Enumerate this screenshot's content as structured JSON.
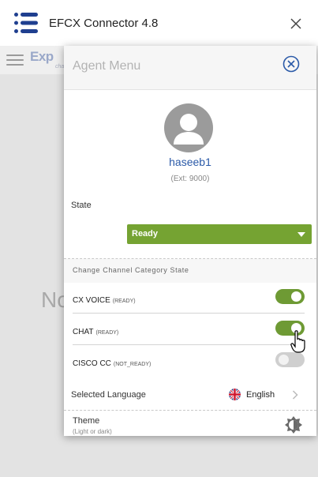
{
  "window": {
    "title": "EFCX Connector 4.8"
  },
  "background_app": {
    "logo_text": "Exp",
    "logo_subtext": "cha",
    "center_text": "No"
  },
  "agent_menu": {
    "title": "Agent Menu",
    "user": {
      "name": "haseeb1",
      "ext": "(Ext: 9000)"
    },
    "state": {
      "label": "State",
      "selected": "Ready"
    },
    "channel_section": {
      "heading": "Change Channel Category State",
      "channels": [
        {
          "name": "CX VOICE",
          "status": "(READY)",
          "enabled": true
        },
        {
          "name": "CHAT",
          "status": "(READY)",
          "enabled": true
        },
        {
          "name": "CISCO CC",
          "status": "(NOT_READY)",
          "enabled": false
        }
      ]
    },
    "language": {
      "label": "Selected Language",
      "value": "English",
      "flag_icon": "uk-flag-icon"
    },
    "theme": {
      "label": "Theme",
      "sublabel": "(Light or dark)",
      "icon": "theme-toggle-icon"
    }
  },
  "colors": {
    "accent_green": "#75a332",
    "toggle_green": "#6e9a34",
    "brand_blue": "#1f3f8f",
    "link_blue": "#2b5aa8"
  }
}
